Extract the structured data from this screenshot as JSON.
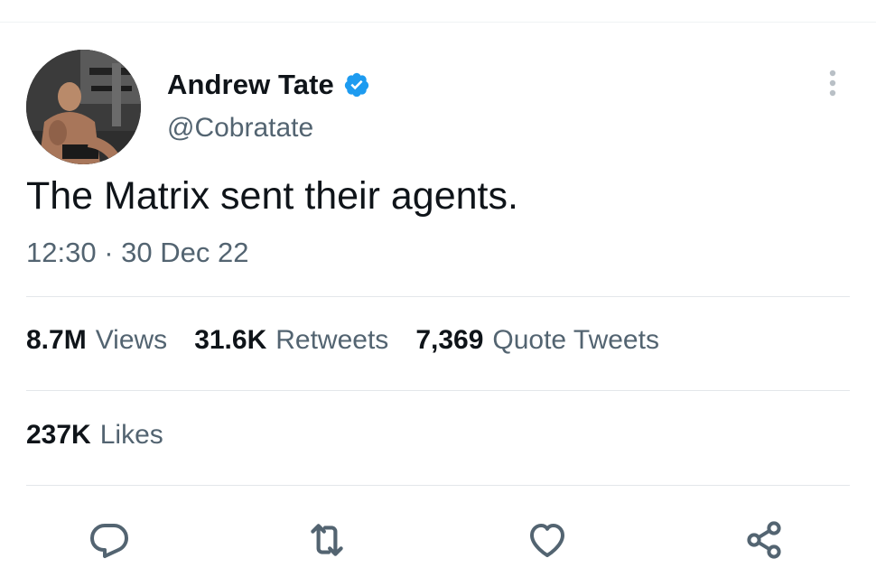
{
  "tweet": {
    "author": {
      "display_name": "Andrew Tate",
      "handle": "@Cobratate",
      "verified": true
    },
    "text": "The Matrix sent their agents.",
    "time": "12:30",
    "separator": "·",
    "date": "30 Dec 22",
    "stats": {
      "views_count": "8.7M",
      "views_label": "Views",
      "retweets_count": "31.6K",
      "retweets_label": "Retweets",
      "quotes_count": "7,369",
      "quotes_label": "Quote Tweets",
      "likes_count": "237K",
      "likes_label": "Likes"
    },
    "actions": [
      {
        "icon": "reply-icon"
      },
      {
        "icon": "retweet-icon"
      },
      {
        "icon": "like-icon"
      },
      {
        "icon": "share-icon"
      }
    ]
  },
  "colors": {
    "text_primary": "#0f1419",
    "text_secondary": "#536471",
    "verified_blue": "#1d9bf0",
    "divider": "#e3e7ea"
  }
}
